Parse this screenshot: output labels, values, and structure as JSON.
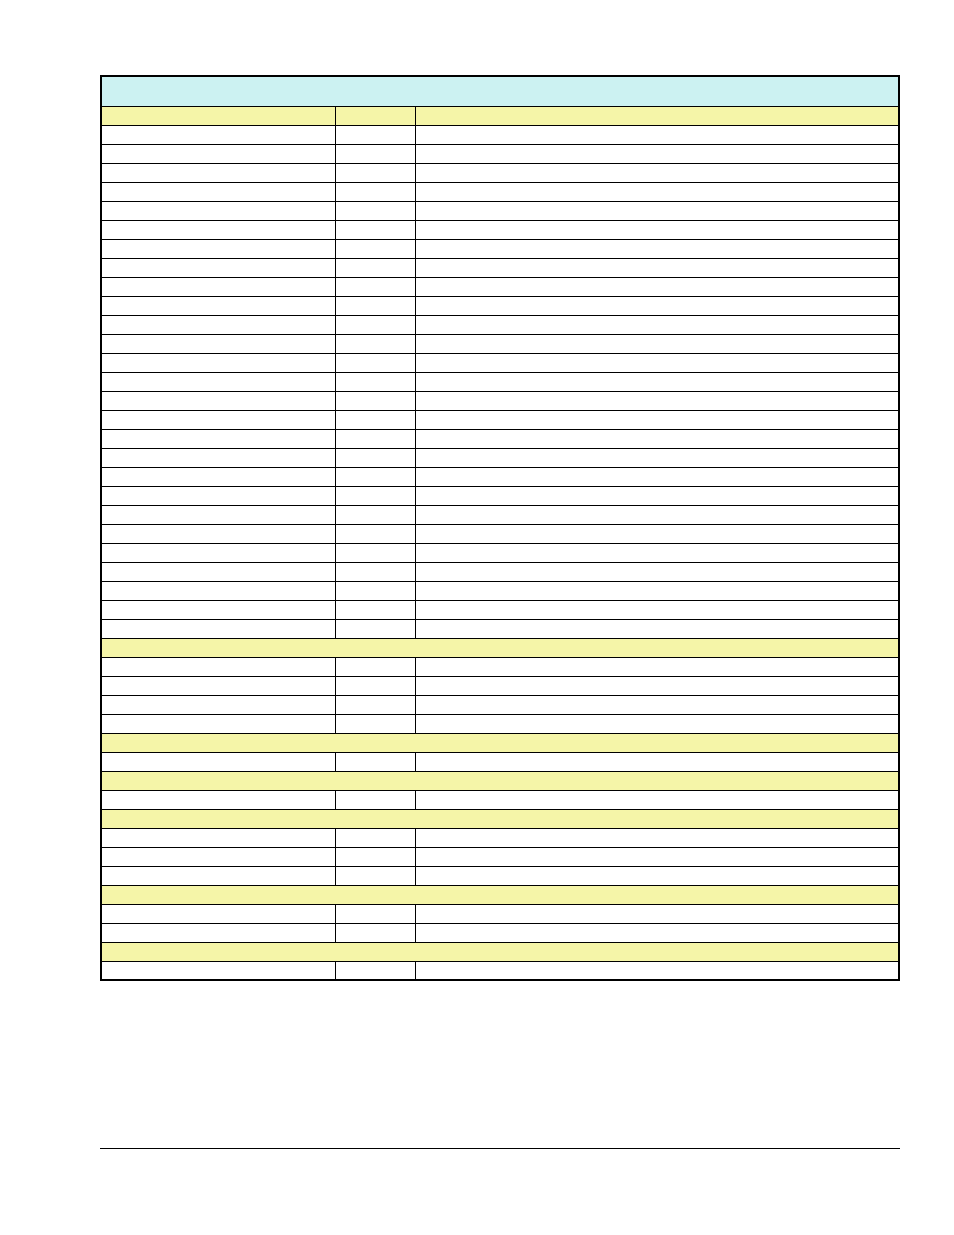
{
  "table": {
    "title": "",
    "sections": [
      {
        "type": "header",
        "cells": [
          "",
          "",
          ""
        ]
      },
      {
        "type": "data",
        "rows": 27,
        "cells": [
          "",
          "",
          ""
        ]
      },
      {
        "type": "section",
        "label": ""
      },
      {
        "type": "data",
        "rows": 4,
        "cells": [
          "",
          "",
          ""
        ]
      },
      {
        "type": "section",
        "label": ""
      },
      {
        "type": "data",
        "rows": 1,
        "cells": [
          "",
          "",
          ""
        ]
      },
      {
        "type": "section",
        "label": ""
      },
      {
        "type": "data",
        "rows": 1,
        "cells": [
          "",
          "",
          ""
        ]
      },
      {
        "type": "section",
        "label": ""
      },
      {
        "type": "data",
        "rows": 3,
        "cells": [
          "",
          "",
          ""
        ]
      },
      {
        "type": "section",
        "label": ""
      },
      {
        "type": "data",
        "rows": 2,
        "cells": [
          "",
          "",
          ""
        ]
      },
      {
        "type": "section",
        "label": ""
      },
      {
        "type": "data",
        "rows": 1,
        "cells": [
          "",
          "",
          ""
        ]
      }
    ]
  }
}
